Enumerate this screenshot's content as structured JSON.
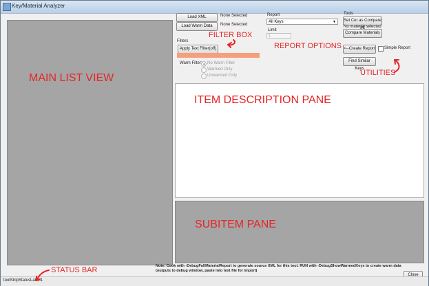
{
  "window": {
    "title": "Key/Material Analyzer"
  },
  "left": {
    "load_xml": "Load XML",
    "load_warm": "Load Warm Data",
    "none1": "None Selected",
    "none2": "None Selected"
  },
  "filters": {
    "group": "Filters",
    "apply_button": "Apply Text Filter(off)",
    "warm_label": "Warm Filter:",
    "options": [
      "No Warm Filter",
      "Warmed Only",
      "Unwarmed Only"
    ]
  },
  "report": {
    "label": "Report",
    "selected": "All Keys",
    "limit_label": "Limit",
    "limit_value": "1",
    "create_button": "<--Create Report",
    "simple_label": "Simple Report"
  },
  "tools": {
    "label": "Tools",
    "set_cur": "Set Cur as Compare Mt",
    "no_material": "No material selected",
    "compare": "Compare Materials",
    "find_similar": "Find Similar Keys"
  },
  "note": "Note: Cook with -DebugFullMaterialReport to generate source XML for this tool. RUN with -DebugShowWarmedKeys to create warm data (outputs to debug window, paste into text file for import)",
  "close_button": "Close",
  "status_label": "toolStripStatusLabel1",
  "annotations": {
    "main_list": "MAIN LIST VIEW",
    "filter_box": "FILTER BOX",
    "report_options": "REPORT OPTIONS",
    "utilities": "UTILITIES",
    "item_desc": "ITEM DESCRIPTION PANE",
    "subitem": "SUBITEM PANE",
    "status_bar": "STATUS BAR"
  },
  "colors": {
    "annotation": "#e62424",
    "filter_bar": "#f4a07a"
  }
}
